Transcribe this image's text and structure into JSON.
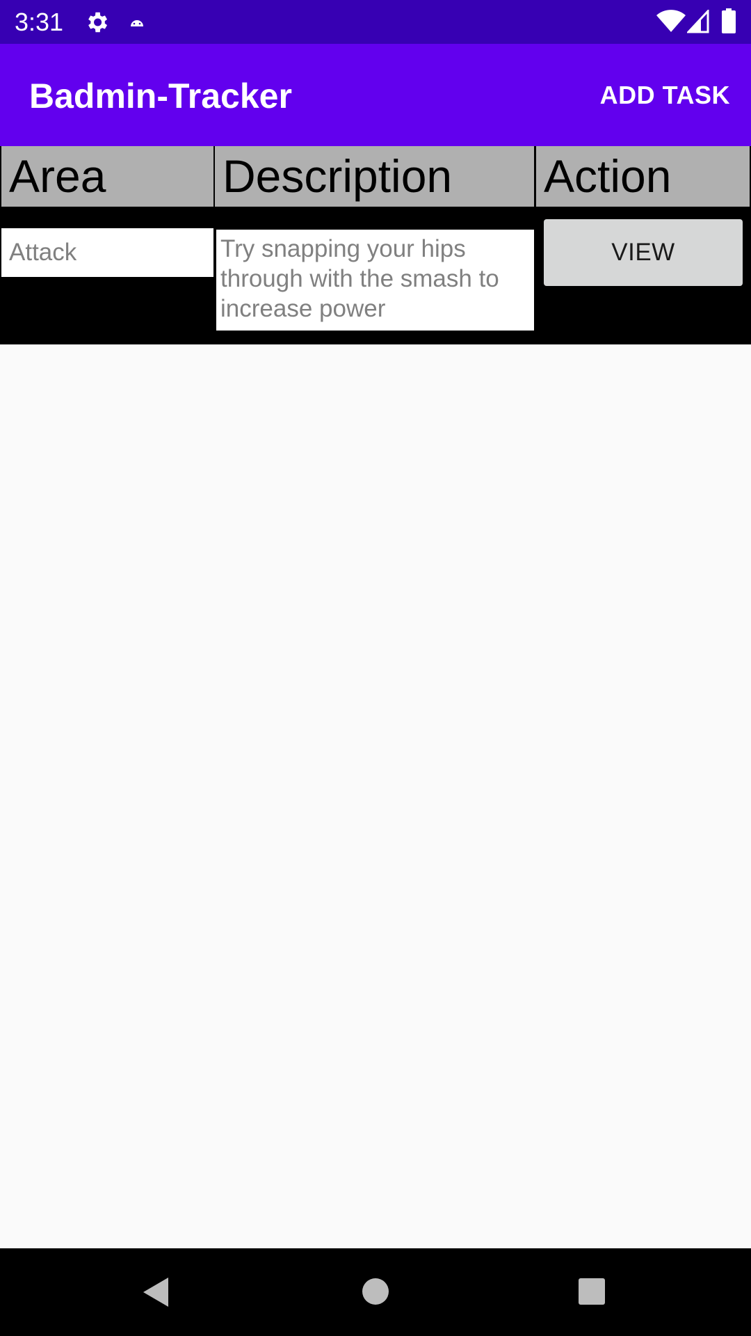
{
  "status_bar": {
    "time": "3:31",
    "icons": [
      "gear-icon",
      "android-icon",
      "wifi-icon",
      "signal-icon",
      "battery-icon"
    ]
  },
  "app_bar": {
    "title": "Badmin-Tracker",
    "add_task_label": "ADD TASK"
  },
  "table": {
    "headers": [
      "Area",
      "Description",
      "Action"
    ],
    "rows": [
      {
        "area": "Attack",
        "description": "Try snapping your hips through with the smash to increase power",
        "action_label": "VIEW"
      }
    ]
  },
  "nav_bar": {
    "icons": [
      "back-icon",
      "home-icon",
      "recents-icon"
    ]
  },
  "colors": {
    "status_bar": "#3700b3",
    "app_bar": "#6200ee",
    "header_bg": "#b0b0b0",
    "table_bg": "#000000",
    "button_bg": "#d6d7d7",
    "page_bg": "#fafafa"
  }
}
